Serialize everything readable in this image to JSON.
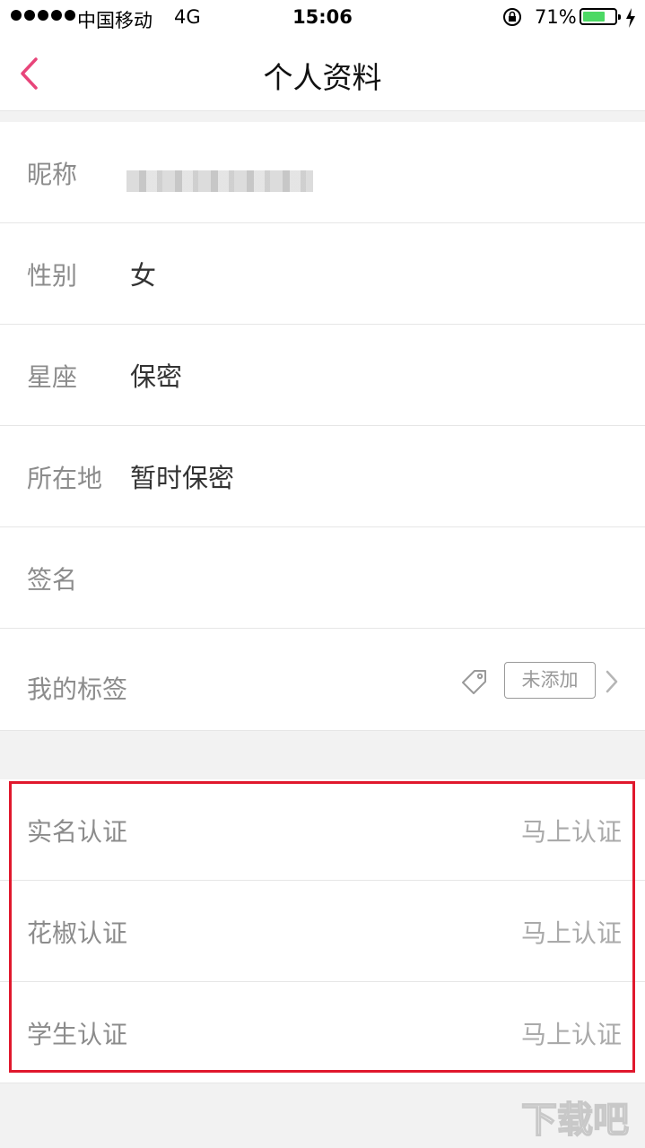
{
  "status_bar": {
    "carrier": "中国移动",
    "network": "4G",
    "time": "15:06",
    "battery_percent": "71%",
    "battery_level": 0.71,
    "battery_color": "#4cd964"
  },
  "nav": {
    "title": "个人资料",
    "back_icon": "chevron-left-icon",
    "accent_color": "#e8457a"
  },
  "profile": [
    {
      "label": "昵称",
      "value": ""
    },
    {
      "label": "性别",
      "value": "女"
    },
    {
      "label": "星座",
      "value": "保密"
    },
    {
      "label": "所在地",
      "value": "暂时保密"
    },
    {
      "label": "签名",
      "value": ""
    },
    {
      "label": "我的标签",
      "tag_button": "未添加",
      "icon": "tag-icon"
    }
  ],
  "verification": [
    {
      "label": "实名认证",
      "action": "马上认证"
    },
    {
      "label": "花椒认证",
      "action": "马上认证"
    },
    {
      "label": "学生认证",
      "action": "马上认证"
    }
  ],
  "highlight_color": "#e0182d",
  "watermark": "下载吧"
}
